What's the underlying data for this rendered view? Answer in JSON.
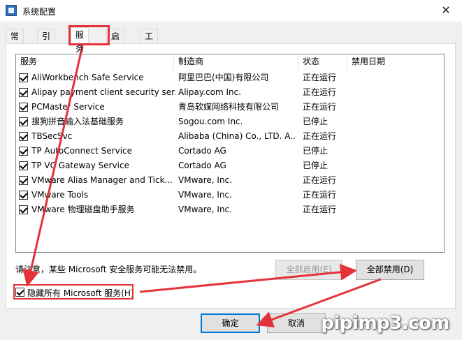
{
  "window": {
    "title": "系统配置",
    "close_glyph": "✕"
  },
  "tabs": [
    {
      "label": "常规"
    },
    {
      "label": "引导"
    },
    {
      "label": "服务"
    },
    {
      "label": "启动"
    },
    {
      "label": "工具"
    }
  ],
  "active_tab": "服务",
  "table": {
    "columns": [
      "服务",
      "制造商",
      "状态",
      "禁用日期"
    ],
    "rows": [
      {
        "name": "AliWorkbench Safe Service",
        "maker": "阿里巴巴(中国)有限公司",
        "status": "正在运行",
        "checked": true
      },
      {
        "name": "Alipay payment client security ser...",
        "maker": "Alipay.com Inc.",
        "status": "正在运行",
        "checked": true
      },
      {
        "name": "PCMaster Service",
        "maker": "青岛软媒网络科技有限公司",
        "status": "正在运行",
        "checked": true
      },
      {
        "name": "搜狗拼音输入法基础服务",
        "maker": "Sogou.com Inc.",
        "status": "已停止",
        "checked": true
      },
      {
        "name": "TBSecSvc",
        "maker": "Alibaba (China) Co., LTD. A...",
        "status": "正在运行",
        "checked": true
      },
      {
        "name": "TP AutoConnect Service",
        "maker": "Cortado AG",
        "status": "已停止",
        "checked": true
      },
      {
        "name": "TP VC Gateway Service",
        "maker": "Cortado AG",
        "status": "已停止",
        "checked": true
      },
      {
        "name": "VMware Alias Manager and Tick...",
        "maker": "VMware, Inc.",
        "status": "正在运行",
        "checked": true
      },
      {
        "name": "VMware Tools",
        "maker": "VMware, Inc.",
        "status": "正在运行",
        "checked": true
      },
      {
        "name": "VMware 物理磁盘助手服务",
        "maker": "VMware, Inc.",
        "status": "正在运行",
        "checked": true
      }
    ]
  },
  "notice": "请注意，某些 Microsoft 安全服务可能无法禁用。",
  "buttons": {
    "enable_all": "全部启用(E)",
    "disable_all": "全部禁用(D)",
    "ok": "确定",
    "cancel": "取消"
  },
  "hide_ms": {
    "label": "隐藏所有 Microsoft 服务(H)",
    "checked": true
  },
  "watermark": "pipimp3.com",
  "colors": {
    "annotation_red": "#e4323b",
    "focus_blue": "#0078d7"
  }
}
